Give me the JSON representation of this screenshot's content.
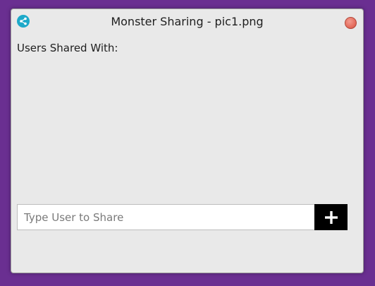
{
  "window": {
    "title": "Monster Sharing - pic1.png",
    "app_icon": "share-icon",
    "close_icon": "close-icon"
  },
  "main": {
    "section_label": "Users Shared With:",
    "shared_users": []
  },
  "share": {
    "input_value": "",
    "input_placeholder": "Type User to Share",
    "add_icon": "plus-icon"
  },
  "colors": {
    "background": "#6a2f91",
    "window": "#e9e9e9",
    "app_icon": "#1da9c9",
    "close_button": "#e56e5f",
    "add_button": "#000000"
  }
}
